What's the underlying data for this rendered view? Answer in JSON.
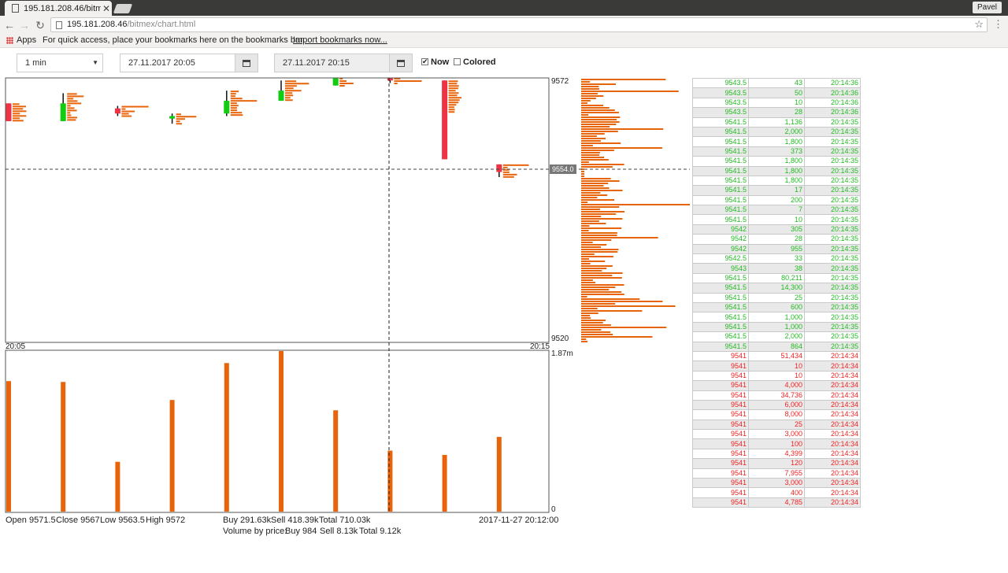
{
  "browser": {
    "tab_title": "195.181.208.46/bitm",
    "user": "Pavel",
    "url_host": "195.181.208.46",
    "url_path": "/bitmex/chart.html",
    "bookmarks_apps": "Apps",
    "bookmarks_hint": "For quick access, place your bookmarks here on the bookmarks bar.",
    "bookmarks_import": "Import bookmarks now..."
  },
  "controls": {
    "interval": "1 min",
    "from_date": "27.11.2017 20:05",
    "to_date": "27.11.2017 20:15",
    "now_label": "Now",
    "now_checked": true,
    "colored_label": "Colored",
    "colored_checked": false
  },
  "chart_data": {
    "type": "candlestick",
    "price_axis": {
      "max": "9572",
      "min": "9520"
    },
    "time_axis": {
      "start": "20:05",
      "end": "20:15"
    },
    "crosshair_price": "9554.0",
    "volume_axis": {
      "max": "1.87m",
      "min": "0"
    },
    "colors": {
      "up": "#11cc11",
      "down": "#ee3344",
      "volume": "#e8640a"
    },
    "candles": [
      {
        "time": "20:05",
        "open": 9567,
        "close": 9563.5,
        "low": 9563.5,
        "high": 9567,
        "volume": 1.52
      },
      {
        "time": "20:06",
        "open": 9563.5,
        "close": 9567,
        "low": 9563.5,
        "high": 9569,
        "volume": 1.51
      },
      {
        "time": "20:07",
        "open": 9566,
        "close": 9565,
        "low": 9564.5,
        "high": 9566.5,
        "volume": 0.58
      },
      {
        "time": "20:08",
        "open": 9564,
        "close": 9564.5,
        "low": 9563,
        "high": 9565,
        "volume": 1.3
      },
      {
        "time": "20:09",
        "open": 9565,
        "close": 9567.5,
        "low": 9564.5,
        "high": 9569.5,
        "volume": 1.73
      },
      {
        "time": "20:10",
        "open": 9567.5,
        "close": 9569.5,
        "low": 9567.5,
        "high": 9571.5,
        "volume": 1.87
      },
      {
        "time": "20:11",
        "open": 9570.5,
        "close": 9572,
        "low": 9570.5,
        "high": 9572,
        "volume": 1.18
      },
      {
        "time": "20:12",
        "open": 9572,
        "close": 9571.5,
        "low": 9571,
        "high": 9572,
        "volume": 0.71
      },
      {
        "time": "20:13",
        "open": 9571.5,
        "close": 9556,
        "low": 9565,
        "high": 9571.5,
        "volume": 0.66
      },
      {
        "time": "20:14",
        "open": 9555,
        "close": 9553.5,
        "low": 9552.5,
        "high": 9555,
        "volume": 0.87
      }
    ]
  },
  "footer": {
    "open": "Open 9571.5",
    "close": "Close 9567",
    "low": "Low 9563.5",
    "high": "High 9572",
    "buy": "Buy 291.63k",
    "sell": "Sell 418.39k",
    "total": "Total 710.03k",
    "timestamp": "2017-11-27 20:12:00",
    "vbp_label": "Volume by price:",
    "vbp_buy": "Buy 984",
    "vbp_sell": "Sell 8.13k",
    "vbp_total": "Total 9.12k"
  },
  "trades": [
    {
      "price": "9543.5",
      "size": "43",
      "time": "20:14:36",
      "side": "buy"
    },
    {
      "price": "9543.5",
      "size": "50",
      "time": "20:14:36",
      "side": "buy"
    },
    {
      "price": "9543.5",
      "size": "10",
      "time": "20:14:36",
      "side": "buy"
    },
    {
      "price": "9543.5",
      "size": "28",
      "time": "20:14:36",
      "side": "buy"
    },
    {
      "price": "9541.5",
      "size": "1,136",
      "time": "20:14:35",
      "side": "buy"
    },
    {
      "price": "9541.5",
      "size": "2,000",
      "time": "20:14:35",
      "side": "buy"
    },
    {
      "price": "9541.5",
      "size": "1,800",
      "time": "20:14:35",
      "side": "buy"
    },
    {
      "price": "9541.5",
      "size": "373",
      "time": "20:14:35",
      "side": "buy"
    },
    {
      "price": "9541.5",
      "size": "1,800",
      "time": "20:14:35",
      "side": "buy"
    },
    {
      "price": "9541.5",
      "size": "1,800",
      "time": "20:14:35",
      "side": "buy"
    },
    {
      "price": "9541.5",
      "size": "1,800",
      "time": "20:14:35",
      "side": "buy"
    },
    {
      "price": "9541.5",
      "size": "17",
      "time": "20:14:35",
      "side": "buy"
    },
    {
      "price": "9541.5",
      "size": "200",
      "time": "20:14:35",
      "side": "buy"
    },
    {
      "price": "9541.5",
      "size": "7",
      "time": "20:14:35",
      "side": "buy"
    },
    {
      "price": "9541.5",
      "size": "10",
      "time": "20:14:35",
      "side": "buy"
    },
    {
      "price": "9542",
      "size": "305",
      "time": "20:14:35",
      "side": "buy"
    },
    {
      "price": "9542",
      "size": "28",
      "time": "20:14:35",
      "side": "buy"
    },
    {
      "price": "9542",
      "size": "955",
      "time": "20:14:35",
      "side": "buy"
    },
    {
      "price": "9542.5",
      "size": "33",
      "time": "20:14:35",
      "side": "buy"
    },
    {
      "price": "9543",
      "size": "38",
      "time": "20:14:35",
      "side": "buy"
    },
    {
      "price": "9541.5",
      "size": "80,211",
      "time": "20:14:35",
      "side": "buy"
    },
    {
      "price": "9541.5",
      "size": "14,300",
      "time": "20:14:35",
      "side": "buy"
    },
    {
      "price": "9541.5",
      "size": "25",
      "time": "20:14:35",
      "side": "buy"
    },
    {
      "price": "9541.5",
      "size": "600",
      "time": "20:14:35",
      "side": "buy"
    },
    {
      "price": "9541.5",
      "size": "1,000",
      "time": "20:14:35",
      "side": "buy"
    },
    {
      "price": "9541.5",
      "size": "1,000",
      "time": "20:14:35",
      "side": "buy"
    },
    {
      "price": "9541.5",
      "size": "2,000",
      "time": "20:14:35",
      "side": "buy"
    },
    {
      "price": "9541.5",
      "size": "864",
      "time": "20:14:35",
      "side": "buy"
    },
    {
      "price": "9541",
      "size": "51,434",
      "time": "20:14:34",
      "side": "sell"
    },
    {
      "price": "9541",
      "size": "10",
      "time": "20:14:34",
      "side": "sell"
    },
    {
      "price": "9541",
      "size": "10",
      "time": "20:14:34",
      "side": "sell"
    },
    {
      "price": "9541",
      "size": "4,000",
      "time": "20:14:34",
      "side": "sell"
    },
    {
      "price": "9541",
      "size": "34,736",
      "time": "20:14:34",
      "side": "sell"
    },
    {
      "price": "9541",
      "size": "6,000",
      "time": "20:14:34",
      "side": "sell"
    },
    {
      "price": "9541",
      "size": "8,000",
      "time": "20:14:34",
      "side": "sell"
    },
    {
      "price": "9541",
      "size": "25",
      "time": "20:14:34",
      "side": "sell"
    },
    {
      "price": "9541",
      "size": "3,000",
      "time": "20:14:34",
      "side": "sell"
    },
    {
      "price": "9541",
      "size": "100",
      "time": "20:14:34",
      "side": "sell"
    },
    {
      "price": "9541",
      "size": "4,399",
      "time": "20:14:34",
      "side": "sell"
    },
    {
      "price": "9541",
      "size": "120",
      "time": "20:14:34",
      "side": "sell"
    },
    {
      "price": "9541",
      "size": "7,955",
      "time": "20:14:34",
      "side": "sell"
    },
    {
      "price": "9541",
      "size": "3,000",
      "time": "20:14:34",
      "side": "sell"
    },
    {
      "price": "9541",
      "size": "400",
      "time": "20:14:34",
      "side": "sell"
    },
    {
      "price": "9541",
      "size": "4,785",
      "time": "20:14:34",
      "side": "sell"
    }
  ]
}
